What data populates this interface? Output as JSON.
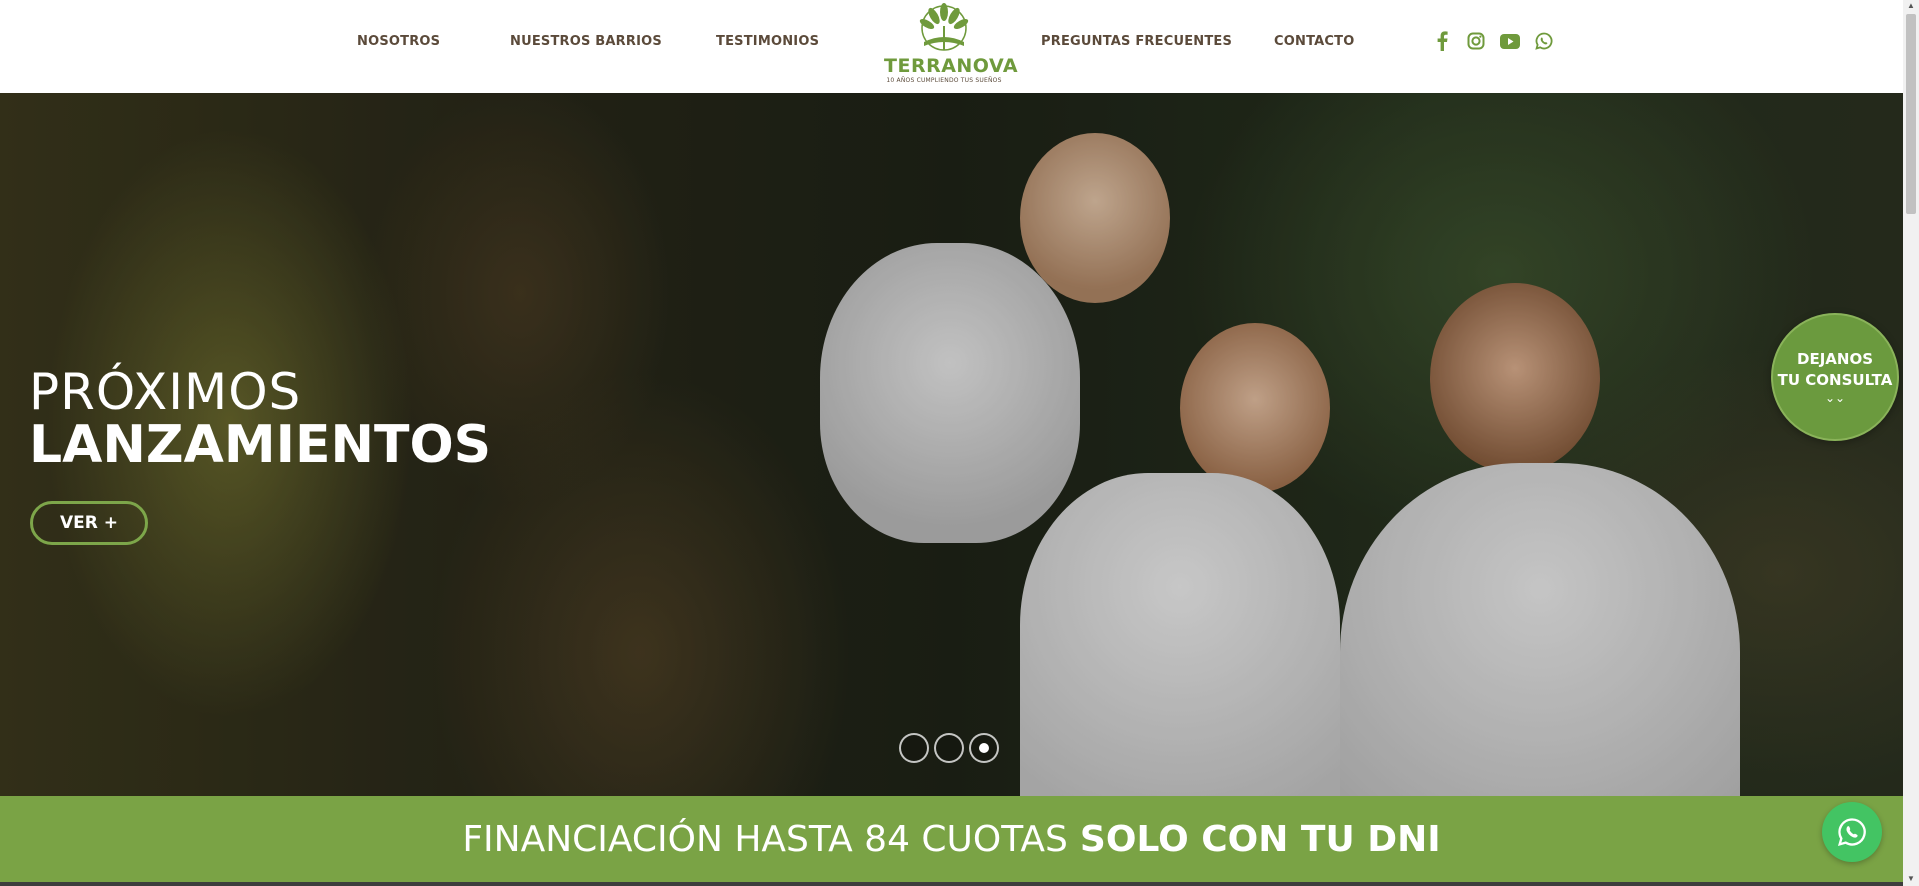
{
  "nav": {
    "left": [
      "NOSOTROS",
      "NUESTROS BARRIOS",
      "TESTIMONIOS"
    ],
    "right": [
      "PREGUNTAS FRECUENTES",
      "CONTACTO"
    ]
  },
  "logo": {
    "name": "TERRANOVA",
    "tagline": "10 AÑOS CUMPLIENDO TUS SUEÑOS"
  },
  "social": [
    "facebook-icon",
    "instagram-icon",
    "youtube-icon",
    "whatsapp-icon"
  ],
  "hero": {
    "title_light": "PRÓXIMOS",
    "title_bold": "LANZAMIENTOS",
    "button": "VER +",
    "slides": 3,
    "active_slide": 3
  },
  "consulta": {
    "line1": "DEJANOS",
    "line2": "TU CONSULTA",
    "arrow": "⌄⌄"
  },
  "banner": {
    "light": "FINANCIACIÓN HASTA 84 CUOTAS",
    "bold": "SOLO CON TU DNI"
  },
  "colors": {
    "brand_green": "#7aa345",
    "nav_text": "#5b4a3a",
    "whatsapp": "#43c463"
  }
}
